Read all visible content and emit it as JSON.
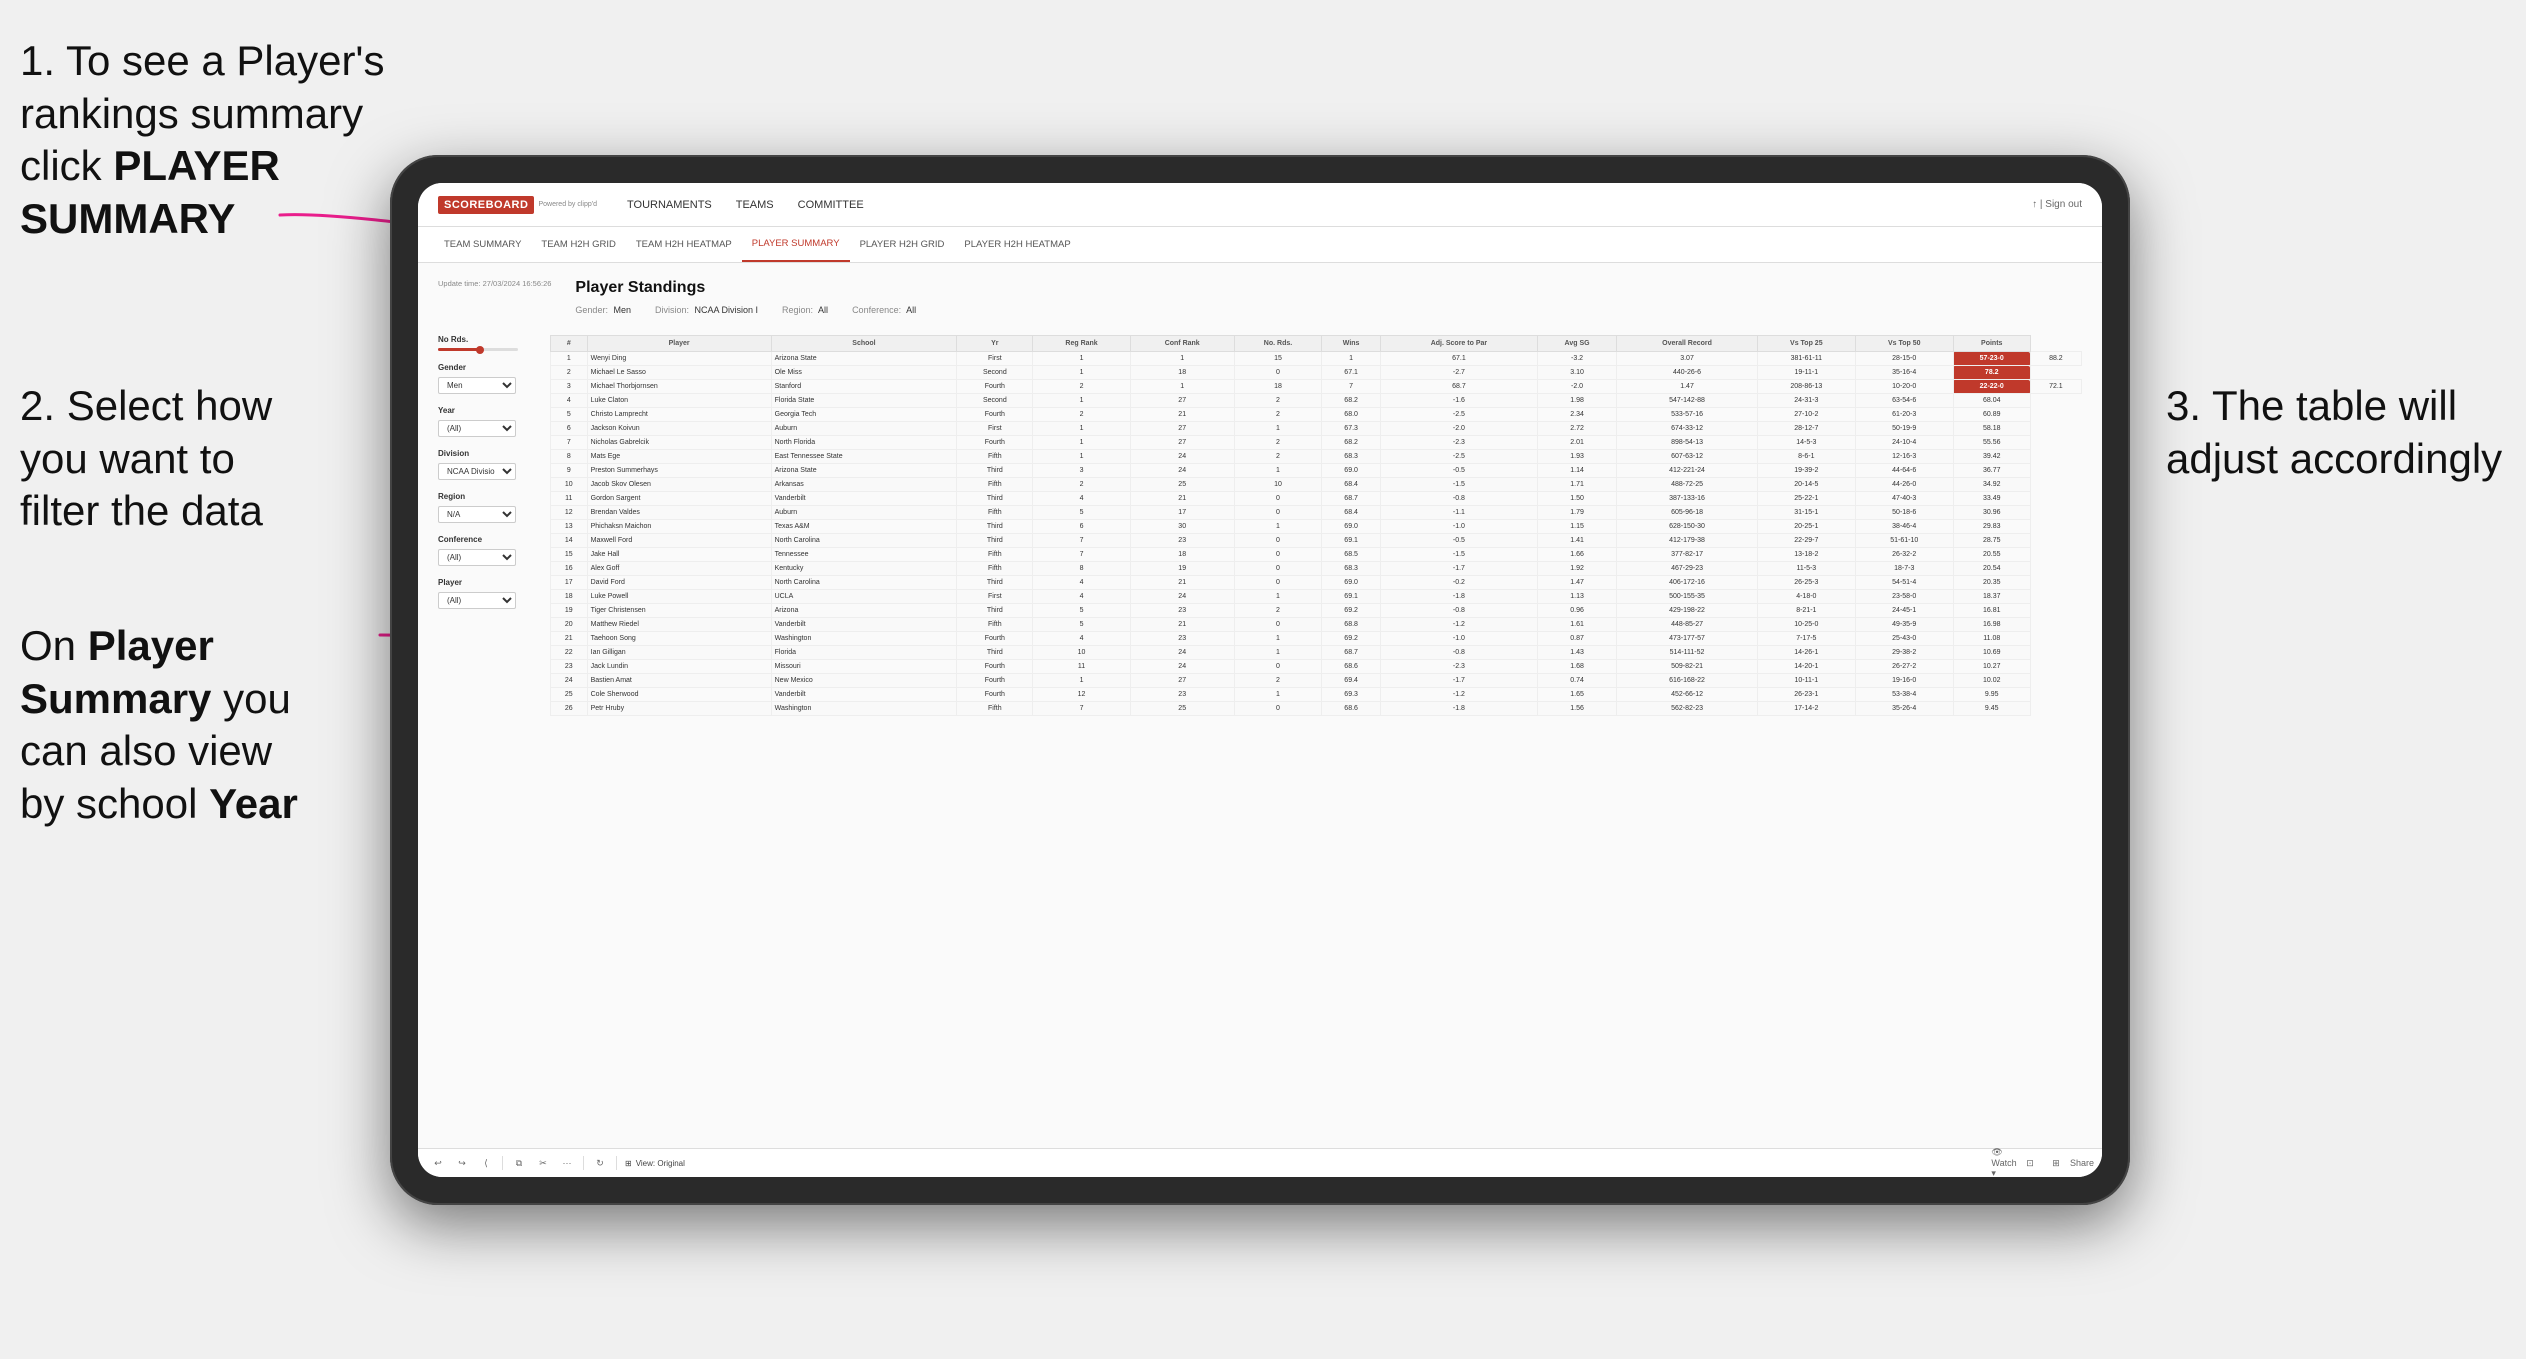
{
  "instructions": {
    "step1": "1. To see a Player's rankings summary click ",
    "step1_bold": "PLAYER SUMMARY",
    "step2_line1": "2. Select how",
    "step2_line2": "you want to",
    "step2_line3": "filter the data",
    "step3_line1": "3. The table will",
    "step3_line2": "adjust accordingly",
    "bottom_line1": "On ",
    "bottom_bold1": "Player",
    "bottom_line2": " ",
    "bottom_bold2": "Summary",
    "bottom_line3": " you can also view by school ",
    "bottom_bold3": "Year"
  },
  "tablet": {
    "brand": "SCOREBOARD",
    "brand_sub": "Powered by clipp'd",
    "nav": [
      "TOURNAMENTS",
      "TEAMS",
      "COMMITTEE"
    ],
    "nav_right": "↑ | Sign out",
    "subnav": [
      "TEAM SUMMARY",
      "TEAM H2H GRID",
      "TEAM H2H HEATMAP",
      "PLAYER SUMMARY",
      "PLAYER H2H GRID",
      "PLAYER H2H HEATMAP"
    ],
    "active_subnav": "PLAYER SUMMARY",
    "update_time": "Update time:\n27/03/2024 16:56:26",
    "page_title": "Player Standings",
    "filters": [
      {
        "label": "Gender:",
        "value": "Men"
      },
      {
        "label": "Division:",
        "value": "NCAA Division I"
      },
      {
        "label": "Region:",
        "value": "All"
      },
      {
        "label": "Conference:",
        "value": "All"
      }
    ],
    "left_panel": {
      "no_rds_label": "No Rds.",
      "gender_label": "Gender",
      "gender_value": "Men",
      "year_label": "Year",
      "year_value": "(All)",
      "division_label": "Division",
      "division_value": "NCAA Division I",
      "region_label": "Region",
      "region_value": "N/A",
      "conference_label": "Conference",
      "conference_value": "(All)",
      "player_label": "Player",
      "player_value": "(All)"
    },
    "table_headers": [
      "#",
      "Player",
      "School",
      "Yr",
      "Reg Rank",
      "Conf Rank",
      "No. Rds.",
      "Wins",
      "Adj. Score to Par",
      "Avg SG",
      "Overall Record",
      "Vs Top 25",
      "Vs Top 50",
      "Points"
    ],
    "table_rows": [
      [
        "1",
        "Wenyi Ding",
        "Arizona State",
        "First",
        "1",
        "1",
        "15",
        "1",
        "67.1",
        "-3.2",
        "3.07",
        "381-61-11",
        "28-15-0",
        "57-23-0",
        "88.2"
      ],
      [
        "2",
        "Michael Le Sasso",
        "Ole Miss",
        "Second",
        "1",
        "18",
        "0",
        "67.1",
        "-2.7",
        "3.10",
        "440-26-6",
        "19-11-1",
        "35-16-4",
        "78.2"
      ],
      [
        "3",
        "Michael Thorbjornsen",
        "Stanford",
        "Fourth",
        "2",
        "1",
        "18",
        "7",
        "68.7",
        "-2.0",
        "1.47",
        "208-86-13",
        "10-20-0",
        "22-22-0",
        "72.1"
      ],
      [
        "4",
        "Luke Claton",
        "Florida State",
        "Second",
        "1",
        "27",
        "2",
        "68.2",
        "-1.6",
        "1.98",
        "547-142-88",
        "24-31-3",
        "63-54-6",
        "68.04"
      ],
      [
        "5",
        "Christo Lamprecht",
        "Georgia Tech",
        "Fourth",
        "2",
        "21",
        "2",
        "68.0",
        "-2.5",
        "2.34",
        "533-57-16",
        "27-10-2",
        "61-20-3",
        "60.89"
      ],
      [
        "6",
        "Jackson Koivun",
        "Auburn",
        "First",
        "1",
        "27",
        "1",
        "67.3",
        "-2.0",
        "2.72",
        "674-33-12",
        "28-12-7",
        "50-19-9",
        "58.18"
      ],
      [
        "7",
        "Nicholas Gabrelcik",
        "North Florida",
        "Fourth",
        "1",
        "27",
        "2",
        "68.2",
        "-2.3",
        "2.01",
        "898-54-13",
        "14-5-3",
        "24-10-4",
        "55.56"
      ],
      [
        "8",
        "Mats Ege",
        "East Tennessee State",
        "Fifth",
        "1",
        "24",
        "2",
        "68.3",
        "-2.5",
        "1.93",
        "607-63-12",
        "8-6-1",
        "12-16-3",
        "39.42"
      ],
      [
        "9",
        "Preston Summerhays",
        "Arizona State",
        "Third",
        "3",
        "24",
        "1",
        "69.0",
        "-0.5",
        "1.14",
        "412-221-24",
        "19-39-2",
        "44-64-6",
        "36.77"
      ],
      [
        "10",
        "Jacob Skov Olesen",
        "Arkansas",
        "Fifth",
        "2",
        "25",
        "10",
        "68.4",
        "-1.5",
        "1.71",
        "488-72-25",
        "20-14-5",
        "44-26-0",
        "34.92"
      ],
      [
        "11",
        "Gordon Sargent",
        "Vanderbilt",
        "Third",
        "4",
        "21",
        "0",
        "68.7",
        "-0.8",
        "1.50",
        "387-133-16",
        "25-22-1",
        "47-40-3",
        "33.49"
      ],
      [
        "12",
        "Brendan Valdes",
        "Auburn",
        "Fifth",
        "5",
        "17",
        "0",
        "68.4",
        "-1.1",
        "1.79",
        "605-96-18",
        "31-15-1",
        "50-18-6",
        "30.96"
      ],
      [
        "13",
        "Phichaksn Maichon",
        "Texas A&M",
        "Third",
        "6",
        "30",
        "1",
        "69.0",
        "-1.0",
        "1.15",
        "628-150-30",
        "20-25-1",
        "38-46-4",
        "29.83"
      ],
      [
        "14",
        "Maxwell Ford",
        "North Carolina",
        "Third",
        "7",
        "23",
        "0",
        "69.1",
        "-0.5",
        "1.41",
        "412-179-38",
        "22-29-7",
        "51-61-10",
        "28.75"
      ],
      [
        "15",
        "Jake Hall",
        "Tennessee",
        "Fifth",
        "7",
        "18",
        "0",
        "68.5",
        "-1.5",
        "1.66",
        "377-82-17",
        "13-18-2",
        "26-32-2",
        "20.55"
      ],
      [
        "16",
        "Alex Goff",
        "Kentucky",
        "Fifth",
        "8",
        "19",
        "0",
        "68.3",
        "-1.7",
        "1.92",
        "467-29-23",
        "11-5-3",
        "18-7-3",
        "20.54"
      ],
      [
        "17",
        "David Ford",
        "North Carolina",
        "Third",
        "4",
        "21",
        "0",
        "69.0",
        "-0.2",
        "1.47",
        "406-172-16",
        "26-25-3",
        "54-51-4",
        "20.35"
      ],
      [
        "18",
        "Luke Powell",
        "UCLA",
        "First",
        "4",
        "24",
        "1",
        "69.1",
        "-1.8",
        "1.13",
        "500-155-35",
        "4-18-0",
        "23-58-0",
        "18.37"
      ],
      [
        "19",
        "Tiger Christensen",
        "Arizona",
        "Third",
        "5",
        "23",
        "2",
        "69.2",
        "-0.8",
        "0.96",
        "429-198-22",
        "8-21-1",
        "24-45-1",
        "16.81"
      ],
      [
        "20",
        "Matthew Riedel",
        "Vanderbilt",
        "Fifth",
        "5",
        "21",
        "0",
        "68.8",
        "-1.2",
        "1.61",
        "448-85-27",
        "10-25-0",
        "49-35-9",
        "16.98"
      ],
      [
        "21",
        "Taehoon Song",
        "Washington",
        "Fourth",
        "4",
        "23",
        "1",
        "69.2",
        "-1.0",
        "0.87",
        "473-177-57",
        "7-17-5",
        "25-43-0",
        "11.08"
      ],
      [
        "22",
        "Ian Gilligan",
        "Florida",
        "Third",
        "10",
        "24",
        "1",
        "68.7",
        "-0.8",
        "1.43",
        "514-111-52",
        "14-26-1",
        "29-38-2",
        "10.69"
      ],
      [
        "23",
        "Jack Lundin",
        "Missouri",
        "Fourth",
        "11",
        "24",
        "0",
        "68.6",
        "-2.3",
        "1.68",
        "509-82-21",
        "14-20-1",
        "26-27-2",
        "10.27"
      ],
      [
        "24",
        "Bastien Amat",
        "New Mexico",
        "Fourth",
        "1",
        "27",
        "2",
        "69.4",
        "-1.7",
        "0.74",
        "616-168-22",
        "10-11-1",
        "19-16-0",
        "10.02"
      ],
      [
        "25",
        "Cole Sherwood",
        "Vanderbilt",
        "Fourth",
        "12",
        "23",
        "1",
        "69.3",
        "-1.2",
        "1.65",
        "452-66-12",
        "26-23-1",
        "53-38-4",
        "9.95"
      ],
      [
        "26",
        "Petr Hruby",
        "Washington",
        "Fifth",
        "7",
        "25",
        "0",
        "68.6",
        "-1.8",
        "1.56",
        "562-82-23",
        "17-14-2",
        "35-26-4",
        "9.45"
      ]
    ],
    "toolbar": {
      "view_label": "View: Original",
      "watch_label": "Watch",
      "share_label": "Share"
    }
  }
}
